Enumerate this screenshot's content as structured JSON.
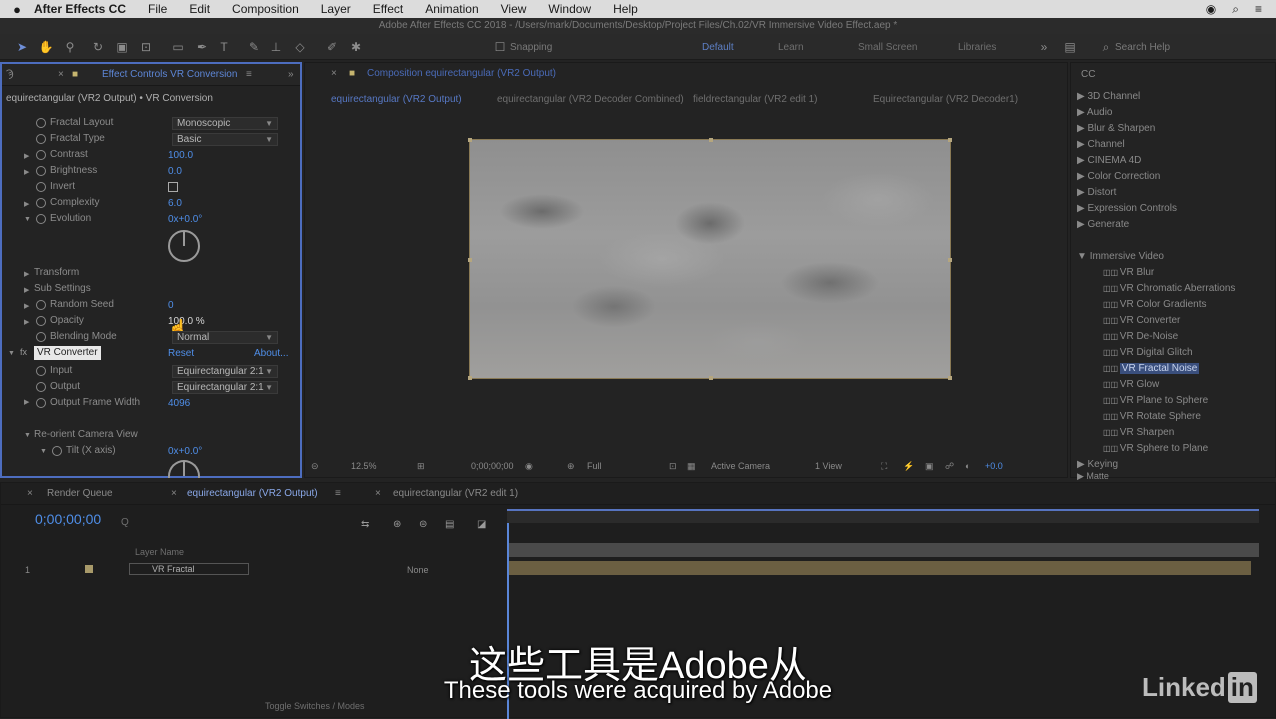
{
  "menubar": {
    "app_name": "After Effects CC",
    "items": [
      "File",
      "Edit",
      "Composition",
      "Layer",
      "Effect",
      "Animation",
      "View",
      "Window",
      "Help"
    ]
  },
  "titlebar": {
    "title": "Adobe After Effects CC 2018 - /Users/mark/Documents/Desktop/Project Files/Ch.02/VR Immersive Video Effect.aep *"
  },
  "toolbar": {
    "workspace_search": "Snapping",
    "workspaces": [
      "Default",
      "Learn",
      "Small Screen",
      "Libraries"
    ],
    "search_help": "Search Help"
  },
  "effect_controls": {
    "tab_label": "Effect Controls VR Conversion",
    "layer_path": "equirectangular (VR2 Output) • VR Conversion",
    "rows": {
      "fractal_layout": "Fractal Layout",
      "fractal_layout_val": "Monoscopic",
      "fractal_type": "Fractal Type",
      "fractal_type_val": "Basic",
      "contrast": "Contrast",
      "contrast_val": "100.0",
      "brightness": "Brightness",
      "brightness_val": "0.0",
      "invert": "Invert",
      "complexity": "Complexity",
      "complexity_val": "6.0",
      "evolution": "Evolution",
      "evolution_val": "0x+0.0°",
      "transform": "Transform",
      "sub_settings": "Sub Settings",
      "random_seed": "Random Seed",
      "random_seed_val": "0",
      "opacity": "Opacity",
      "opacity_val": "100.0 %",
      "blending_mode": "Blending Mode",
      "blending_mode_val": "Normal",
      "vr_converter": "VR Converter",
      "vr_converter_reset": "Reset",
      "vr_converter_about": "About...",
      "input": "Input",
      "input_val": "Equirectangular 2:1",
      "output": "Output",
      "output_val": "Equirectangular 2:1",
      "output_frame_width": "Output Frame Width",
      "output_frame_width_val": "4096",
      "reorient_camera_view": "Re-orient Camera View",
      "tilt": "Tilt (X axis)",
      "tilt_val": "0x+0.0°"
    }
  },
  "composition": {
    "tab_label": "Composition equirectangular (VR2 Output)",
    "breadcrumbs": [
      "equirectangular (VR2 Output)",
      "equirectangular (VR2 Decoder Combined)",
      "fieldrectangular (VR2 edit 1)",
      "Equirectangular (VR2 Decoder1)"
    ],
    "zoom": "12.5%",
    "resolution": "Full",
    "time": "0;00;00;00",
    "camera": "Active Camera",
    "views": "1 View",
    "exposure": "+0.0"
  },
  "project": {
    "search_placeholder": "CC",
    "folders": [
      "3D Channel",
      "Audio",
      "Blur & Sharpen",
      "Channel",
      "CINEMA 4D",
      "Color Correction",
      "Distort",
      "Expression Controls",
      "Generate",
      "Immersive Video"
    ],
    "items": [
      "VR Blur",
      "VR Chromatic Aberrations",
      "VR Color Gradients",
      "VR Converter",
      "VR De-Noise",
      "VR Digital Glitch",
      "VR Fractal Noise",
      "VR Glow",
      "VR Plane to Sphere",
      "VR Rotate Sphere",
      "VR Sharpen",
      "VR Sphere to Plane"
    ],
    "footer_items": [
      "Keying",
      "Matte"
    ],
    "selected_index": 6
  },
  "timeline": {
    "tabs": [
      "Render Queue",
      "equirectangular (VR2 Output)",
      "equirectangular (VR2 edit 1)"
    ],
    "timecode": "0;00;00;00",
    "search_placeholder": "Q",
    "layer_name_header": "Layer Name",
    "layer_row": "1",
    "layer_name": "VR Fractal",
    "mode": "None",
    "footer": "Toggle Switches / Modes"
  },
  "subtitles": {
    "chinese": "这些工具是Adobe从",
    "english": "These tools were acquired by Adobe"
  },
  "watermark": {
    "brand": "Linked",
    "brand_in": "in"
  }
}
